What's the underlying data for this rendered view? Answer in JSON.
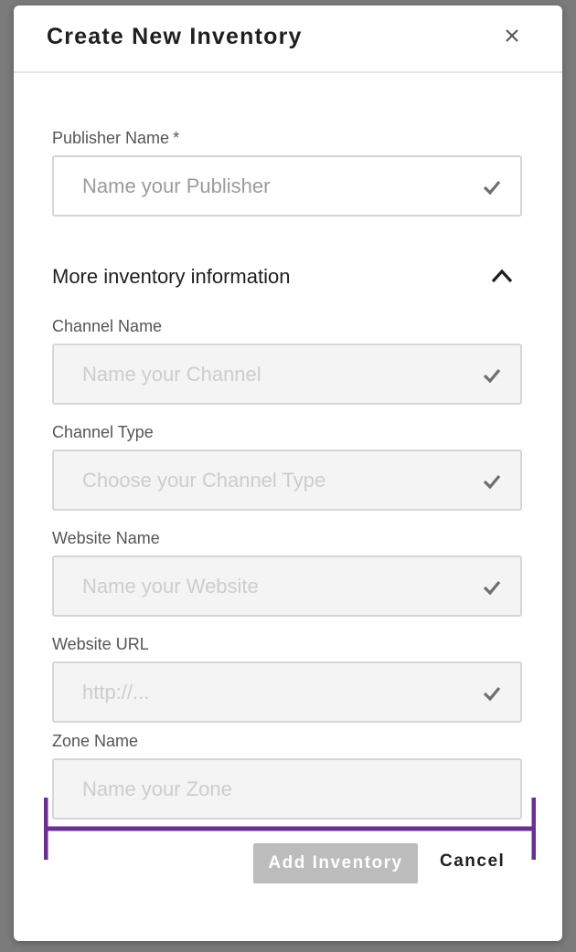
{
  "modal": {
    "title": "Create New Inventory"
  },
  "publisher": {
    "label": "Publisher Name",
    "required_marker": "*",
    "placeholder": "Name your Publisher"
  },
  "more_info": {
    "title": "More inventory information",
    "expanded": true
  },
  "fields": {
    "channel_name": {
      "label": "Channel Name",
      "placeholder": "Name your Channel"
    },
    "channel_type": {
      "label": "Channel Type",
      "placeholder": "Choose your Channel Type"
    },
    "website_name": {
      "label": "Website Name",
      "placeholder": "Name your Website"
    },
    "website_url": {
      "label": "Website URL",
      "placeholder": "http://..."
    },
    "zone_name": {
      "label": "Zone Name",
      "placeholder": "Name your Zone"
    }
  },
  "footer": {
    "add_label": "Add Inventory",
    "cancel_label": "Cancel"
  },
  "colors": {
    "overlay": "#7a7a7a",
    "bracket": "#6a2f92",
    "disabled_button": "#bcbcbc",
    "check": "#6e6e6e"
  },
  "icons": {
    "close": "close-icon",
    "check": "check-icon",
    "collapse": "chevron-up-icon"
  }
}
